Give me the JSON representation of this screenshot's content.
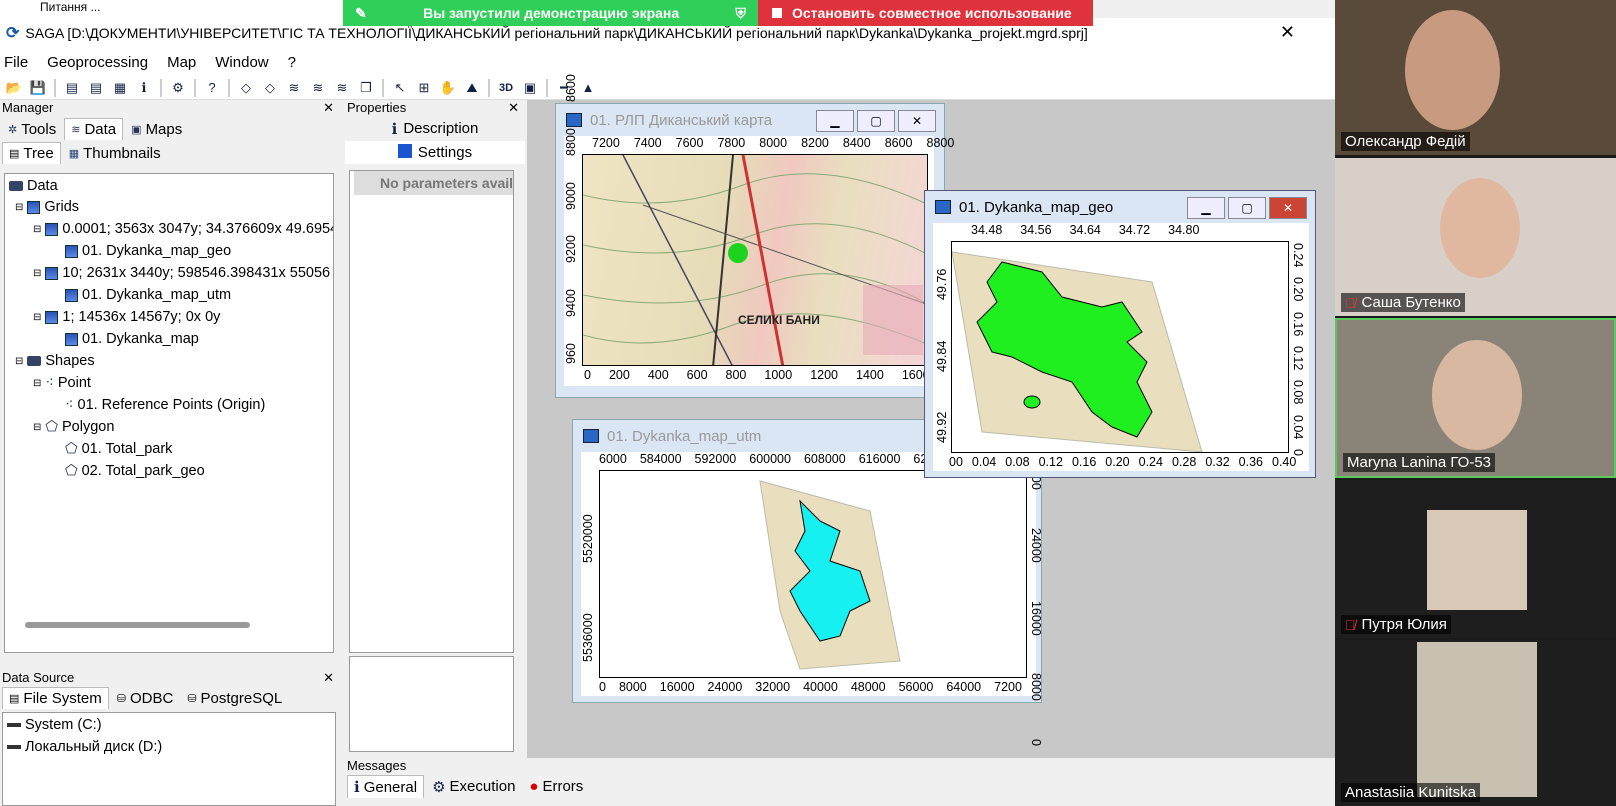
{
  "banners": {
    "sharing": "Вы запустили демонстрацию экрана",
    "stop": "Остановить совместное использование",
    "corner": "Питання ..."
  },
  "app": {
    "title": "SAGA [D:\\ДОКУМЕНТИ\\УНІВЕРСИТЕТ\\ГІС ТА ТЕХНОЛОГІЇ\\ДИКАНСЬКИЙ регіональний парк\\ДИКАНСЬКИЙ регіональний парк\\Dykanka\\Dykanka_projekt.mgrd.sprj]"
  },
  "menu": [
    "File",
    "Geoprocessing",
    "Map",
    "Window",
    "?"
  ],
  "manager": {
    "title": "Manager",
    "tabs": [
      "Tools",
      "Data",
      "Maps"
    ],
    "subtabs": [
      "Tree",
      "Thumbnails"
    ],
    "tree": [
      "Data",
      "Grids",
      "0.0001; 3563x 3047y; 34.376609x 49.6954",
      "01. Dykanka_map_geo",
      "10; 2631x 3440y; 598546.398431x 55056",
      "01. Dykanka_map_utm",
      "1; 14536x 14567y; 0x 0y",
      "01. Dykanka_map",
      "Shapes",
      "Point",
      "01. Reference Points (Origin)",
      "Polygon",
      "01. Total_park",
      "02. Total_park_geo"
    ]
  },
  "datasource": {
    "title": "Data Source",
    "tabs": [
      "File System",
      "ODBC",
      "PostgreSQL"
    ],
    "items": [
      "System (C:)",
      "Локальный диск (D:)"
    ]
  },
  "properties": {
    "title": "Properties",
    "tabs": [
      "Description",
      "Settings"
    ],
    "noparams": "No parameters avail"
  },
  "messages": {
    "title": "Messages",
    "tabs": [
      "General",
      "Execution",
      "Errors"
    ]
  },
  "windows": {
    "map1": {
      "title": "01. РЛП Диканський карта",
      "xtop": [
        "7200",
        "7400",
        "7600",
        "7800",
        "8000",
        "8200",
        "8400",
        "8600",
        "8800"
      ],
      "xbot": [
        "0",
        "200",
        "400",
        "600",
        "800",
        "1000",
        "1200",
        "1400",
        "1600",
        "18"
      ],
      "yleft": [
        "960",
        "9400",
        "9200",
        "9000",
        "8800",
        "8600"
      ],
      "yright": [
        "00"
      ],
      "label": "СЕЛИКІ БАНИ"
    },
    "map2": {
      "title": "01. Dykanka_map_geo",
      "xtop": [
        "34.48",
        "34.56",
        "34.64",
        "34.72",
        "34.80"
      ],
      "xbot": [
        "00",
        "0.04",
        "0.08",
        "0.12",
        "0.16",
        "0.20",
        "0.24",
        "0.28",
        "0.32",
        "0.36",
        "0.40"
      ],
      "yleft": [
        "49.92",
        "49.84",
        "49.76"
      ],
      "yright": [
        "0.24",
        "0.20",
        "0.16",
        "0.12",
        "0.08",
        "0.04",
        "0"
      ]
    },
    "map3": {
      "title": "01. Dykanka_map_utm",
      "xtop": [
        "6000",
        "584000",
        "592000",
        "600000",
        "608000",
        "616000",
        "624000"
      ],
      "xbot": [
        "0",
        "8000",
        "16000",
        "24000",
        "32000",
        "40000",
        "48000",
        "56000",
        "64000",
        "7200"
      ],
      "yleft": [
        "5536000",
        "5520000"
      ],
      "yright": [
        "3200",
        "24000",
        "16000",
        "8000",
        "0"
      ]
    }
  },
  "participants": [
    {
      "name": "Олександр Федій",
      "muted": false
    },
    {
      "name": "Саша Бутенко",
      "muted": true
    },
    {
      "name": "Maryna Lanina ГО-53",
      "muted": false
    },
    {
      "name": "Путря Юлия",
      "muted": true
    },
    {
      "name": "Anastasiia Kunitska",
      "muted": false
    }
  ]
}
